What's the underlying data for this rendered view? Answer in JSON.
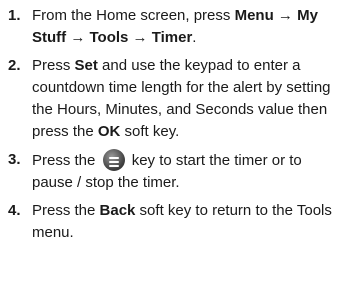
{
  "steps": [
    {
      "number": "1.",
      "t1": "From the Home screen, press ",
      "b1": "Menu → My Stuff → Tools → Timer",
      "t2": "."
    },
    {
      "number": "2.",
      "t1": "Press ",
      "b1": "Set",
      "t2": " and use the keypad to enter a countdown time length for the alert by setting the Hours, Minutes, and Seconds value then press the ",
      "b2": "OK",
      "t3": " soft key."
    },
    {
      "number": "3.",
      "t1": "Press the ",
      "icon": "nav-key-icon",
      "t2": " key to start the timer or to pause / stop the timer."
    },
    {
      "number": "4.",
      "t1": "Press the ",
      "b1": "Back",
      "t2": " soft key to return to the Tools menu."
    }
  ]
}
